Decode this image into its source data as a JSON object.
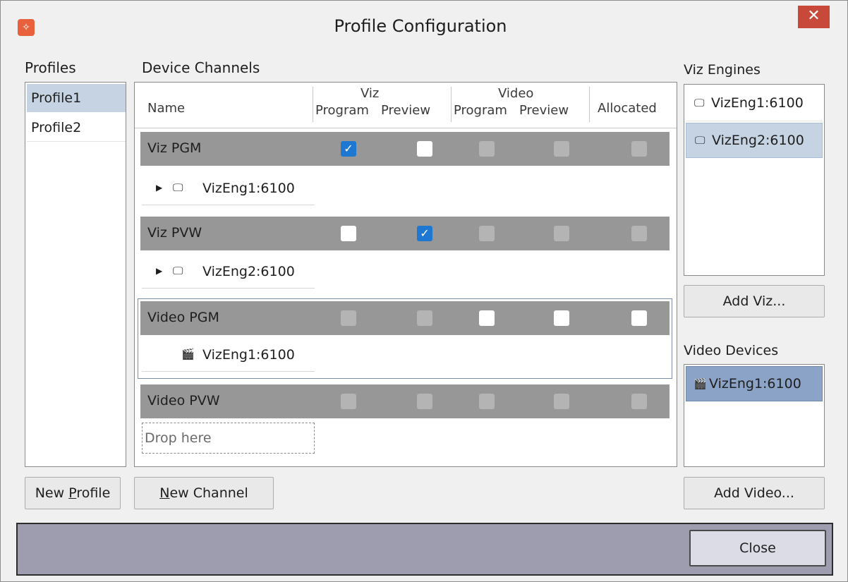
{
  "window": {
    "title": "Profile Configuration",
    "close_glyph": "✕",
    "app_icon_glyph": "✧"
  },
  "profiles": {
    "heading": "Profiles",
    "items": [
      {
        "label": "Profile1"
      },
      {
        "label": "Profile2"
      }
    ],
    "new_button": {
      "prefix": "New ",
      "mnemonic": "P",
      "suffix": "rofile"
    }
  },
  "channels": {
    "heading": "Device Channels",
    "columns": {
      "name": "Name",
      "viz_group": "Viz",
      "video_group": "Video",
      "program": "Program",
      "preview": "Preview",
      "allocated": "Allocated"
    },
    "rows": [
      {
        "name": "Viz PGM",
        "device": "VizEng1:6100",
        "device_icon": "monitor-icon",
        "checks": [
          "checked",
          "unchecked",
          "disabled",
          "disabled",
          "disabled"
        ]
      },
      {
        "name": "Viz PVW",
        "device": "VizEng2:6100",
        "device_icon": "monitor-icon",
        "checks": [
          "unchecked",
          "checked",
          "disabled",
          "disabled",
          "disabled"
        ]
      },
      {
        "name": "Video PGM",
        "device": "VizEng1:6100",
        "device_icon": "video-clapper-icon",
        "checks": [
          "disabled",
          "disabled",
          "unchecked",
          "unchecked",
          "unchecked"
        ]
      },
      {
        "name": "Video PVW",
        "device": null,
        "checks": [
          "disabled",
          "disabled",
          "disabled",
          "disabled",
          "disabled"
        ]
      }
    ],
    "drop_placeholder": "Drop here",
    "new_button": {
      "mnemonic": "N",
      "suffix": "ew Channel"
    }
  },
  "viz_engines": {
    "heading": "Viz Engines",
    "items": [
      {
        "label": "VizEng1:6100"
      },
      {
        "label": "VizEng2:6100"
      }
    ],
    "add_button": "Add Viz..."
  },
  "video_devices": {
    "heading": "Video Devices",
    "items": [
      {
        "label": "VizEng1:6100"
      }
    ],
    "add_button": "Add Video..."
  },
  "footer": {
    "close_button": "Close"
  },
  "glyphs": {
    "monitor": "🖵",
    "clapper": "🎬",
    "expander": "▶",
    "check": "✓"
  },
  "colors": {
    "channel_bar": "#979797",
    "selection": "#c6d3e2",
    "check_blue": "#1e78d2",
    "footer_bg": "#9e9daf",
    "close_red": "#c8493a"
  }
}
